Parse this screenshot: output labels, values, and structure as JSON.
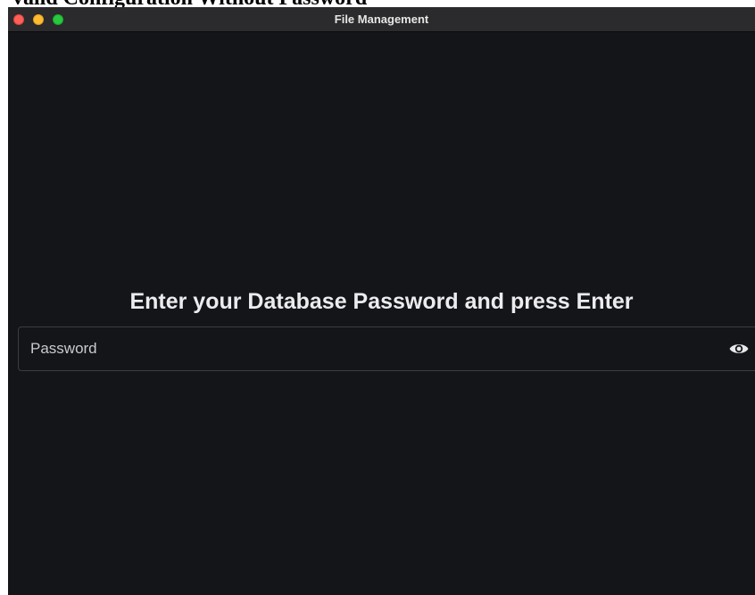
{
  "document": {
    "heading": "valid Configuration Without Password"
  },
  "window": {
    "title": "File Management",
    "controls": [
      "close",
      "minimize",
      "zoom"
    ]
  },
  "main": {
    "prompt": "Enter your Database Password and press Enter",
    "password_field": {
      "placeholder": "Password",
      "value": "",
      "icon": "eye-icon"
    }
  },
  "colors": {
    "background": "#131519",
    "titlebar": "#2b2b2d",
    "prompt_text": "#ececee",
    "field_border": "#3a3d43",
    "close": "#fe5f57",
    "minimize": "#febc2e",
    "zoom": "#28c840"
  }
}
